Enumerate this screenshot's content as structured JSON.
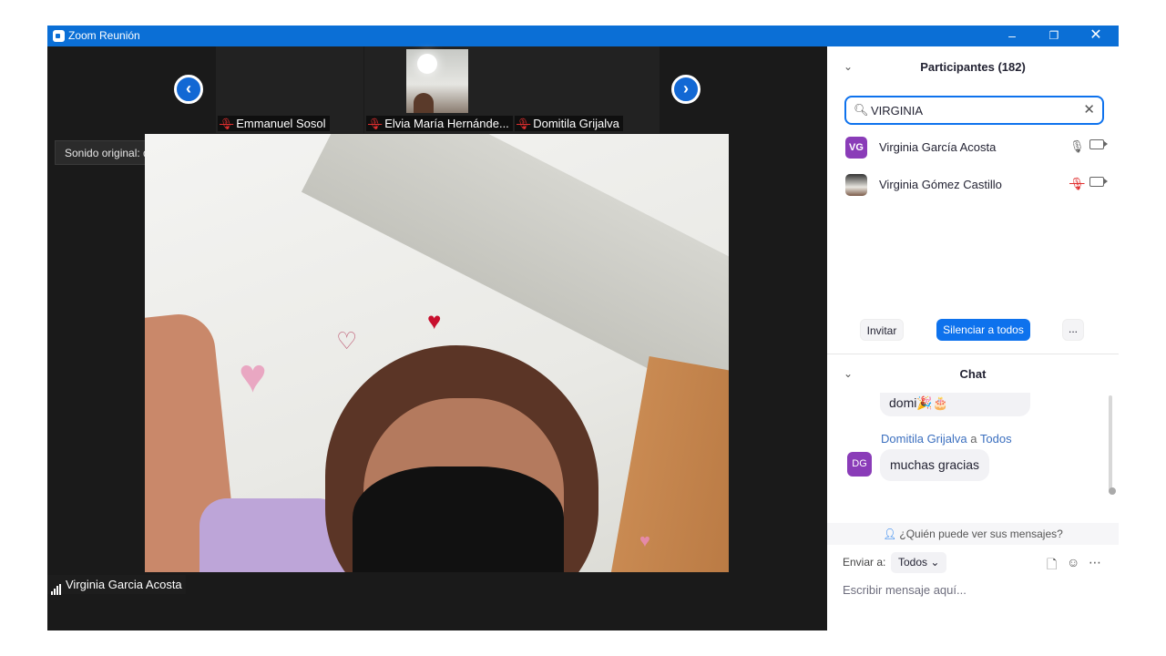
{
  "window": {
    "title": "Zoom Reunión",
    "minimize": "–",
    "maximize": "❐",
    "close": "✕"
  },
  "gallery": {
    "prev": "‹",
    "next": "›",
    "thumbnails": [
      {
        "name": "Emmanuel Sosol",
        "muted": true
      },
      {
        "name": "Elvia María Hernánde...",
        "muted": true
      },
      {
        "name": "Domitila Grijalva",
        "muted": true
      }
    ]
  },
  "sound": {
    "label": "Sonido original: desactivado",
    "dropdown": "▾"
  },
  "active_speaker": {
    "name": "Virginia Garcia Acosta"
  },
  "participants": {
    "header": "Participantes (182)",
    "search_value": "VIRGINIA",
    "list": [
      {
        "initials": "VG",
        "name": "Virginia García Acosta",
        "mic": "🎙",
        "muted": false
      },
      {
        "initials": "",
        "name": "Virginia Gómez Castillo",
        "mic": "🎙",
        "muted": true
      }
    ],
    "invite": "Invitar",
    "mute_all": "Silenciar a todos",
    "more": "..."
  },
  "chat": {
    "header": "Chat",
    "previous_message": "domi🎉🎂",
    "sender": "Domitila Grijalva",
    "to_word": "a",
    "recipient": "Todos",
    "sender_initials": "DG",
    "message": "muchas gracias",
    "privacy": "¿Quién puede ver sus mensajes?",
    "send_to_label": "Enviar a:",
    "send_to_value": "Todos",
    "placeholder": "Escribir mensaje aquí..."
  },
  "colors": {
    "titlebar": "#0b6fd6",
    "accent": "#0e72ed",
    "avatar": "#8a3cb8",
    "muted": "#e02f2f"
  }
}
